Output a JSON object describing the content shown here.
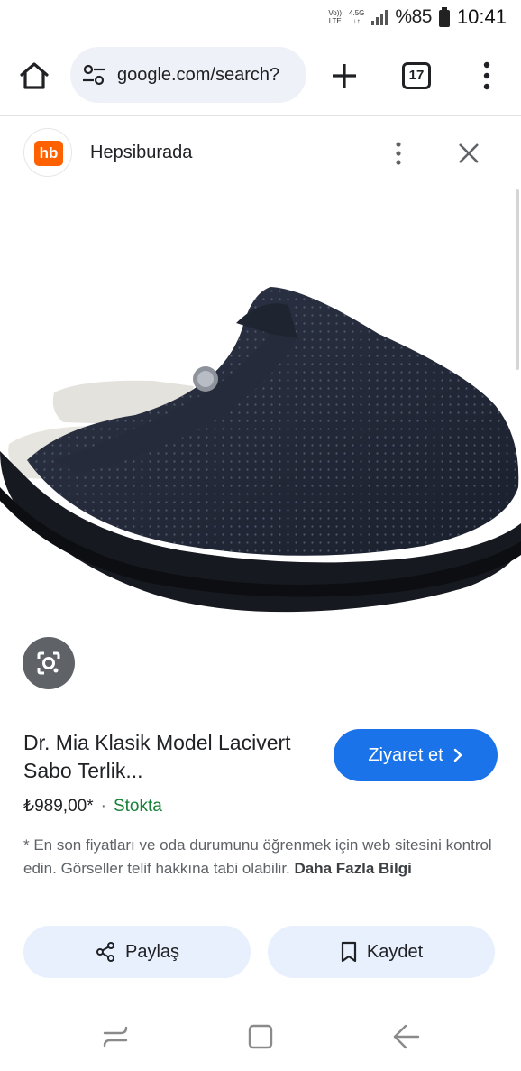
{
  "status_bar": {
    "network_top": "Vo))",
    "network_bottom": "LTE",
    "data_type": "4.5G",
    "battery": "%85",
    "time": "10:41"
  },
  "browser": {
    "url": "google.com/search?",
    "tab_count": "17"
  },
  "source": {
    "logo_text": "hb",
    "name": "Hepsiburada",
    "logo_color": "#ff6000"
  },
  "product": {
    "title": "Dr. Mia Klasik Model Lacivert Sabo Terlik...",
    "visit_label": "Ziyaret et",
    "price": "₺989,00*",
    "separator": "·",
    "stock": "Stokta",
    "disclaimer": "* En son fiyatları ve oda durumunu öğrenmek için web sitesini kontrol edin. Görseller telif hakkına tabi olabilir.",
    "more_info": "Daha Fazla Bilgi"
  },
  "actions": {
    "share_label": "Paylaş",
    "save_label": "Kaydet"
  },
  "colors": {
    "accent": "#1a73e8",
    "stock_green": "#188038",
    "chip_bg": "#e8f0fe"
  }
}
